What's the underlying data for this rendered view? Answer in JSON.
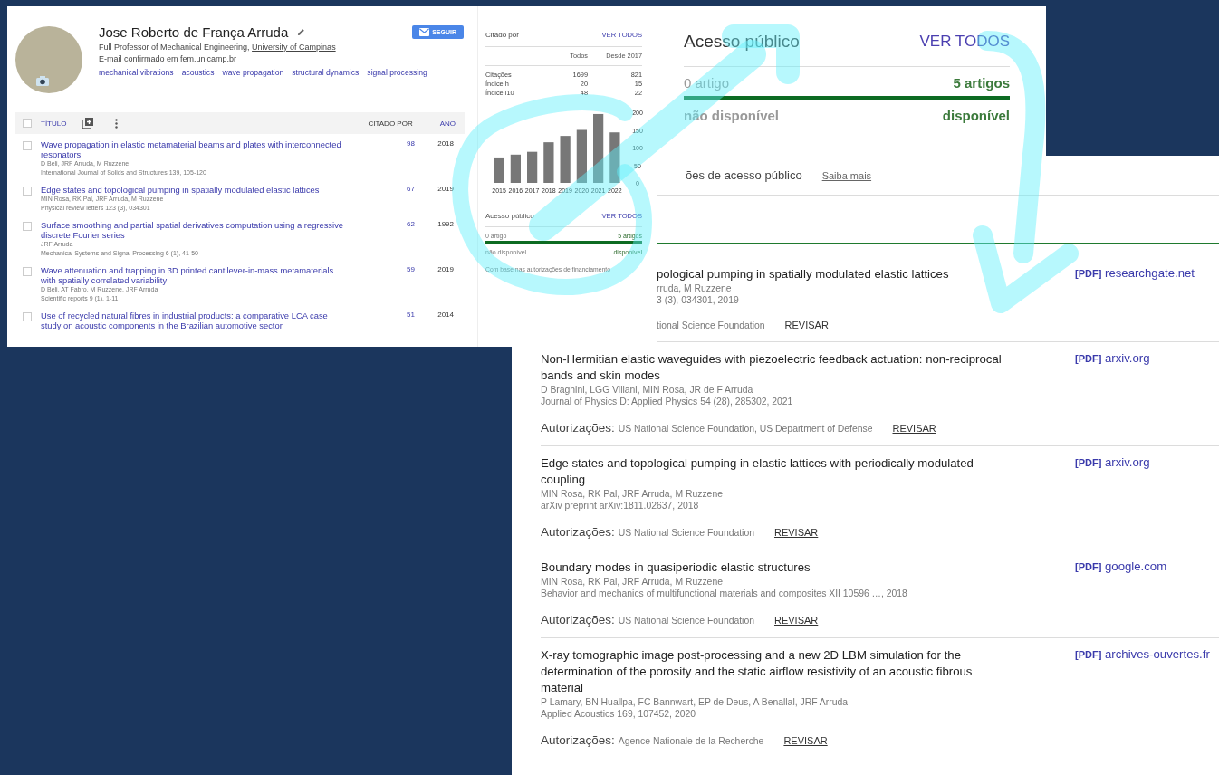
{
  "profile": {
    "name": "Jose Roberto de França Arruda",
    "affiliation": "Full Professor of Mechanical Engineering, ",
    "affiliation_link": "University of Campinas",
    "email": "E-mail confirmado em fem.unicamp.br",
    "interests": [
      "mechanical vibrations",
      "acoustics",
      "wave propagation",
      "structural dynamics",
      "signal processing"
    ],
    "follow_button": "SEGUIR"
  },
  "articles_table": {
    "header_checked": false,
    "columns": [
      {
        "label": "TÍTULO"
      },
      {
        "label": "CITADO POR"
      },
      {
        "label": "ANO"
      }
    ],
    "rows": [
      {
        "checked": false,
        "title": "Wave propagation in elastic metamaterial beams and plates with interconnected resonators",
        "authors": "D Beli, JRF Arruda, M Ruzzene",
        "venue": "International Journal of Solids and Structures 139, 105-120",
        "cited_by": "98",
        "year": "2018"
      },
      {
        "checked": false,
        "title": "Edge states and topological pumping in spatially modulated elastic lattices",
        "authors": "MIN Rosa, RK Pal, JRF Arruda, M Ruzzene",
        "venue": "Physical review letters 123 (3), 034301",
        "cited_by": "67",
        "year": "2019"
      },
      {
        "checked": false,
        "title": "Surface smoothing and partial spatial derivatives computation using a regressive discrete Fourier series",
        "authors": "JRF Arruda",
        "venue": "Mechanical Systems and Signal Processing 6 (1), 41-50",
        "cited_by": "62",
        "year": "1992"
      },
      {
        "checked": false,
        "title": "Wave attenuation and trapping in 3D printed cantilever-in-mass metamaterials with spatially correlated variability",
        "authors": "D Beli, AT Fabro, M Ruzzene, JRF Arruda",
        "venue": "Scientific reports 9 (1), 1-11",
        "cited_by": "59",
        "year": "2019"
      },
      {
        "checked": false,
        "title": "Use of recycled natural fibres in industrial products: a comparative LCA case study on acoustic components in the Brazilian automotive sector",
        "cited_by": "51",
        "year": "2014"
      }
    ]
  },
  "cited_by": {
    "title": "Citado por",
    "link": "VER TODOS",
    "columns": [
      "Todos",
      "Desde 2017"
    ],
    "rows": [
      {
        "label": "Citações",
        "all": "1699",
        "since": "821"
      },
      {
        "label": "Índice h",
        "all": "20",
        "since": "15"
      },
      {
        "label": "Índice i10",
        "all": "48",
        "since": "22"
      }
    ],
    "chart_data": {
      "type": "bar",
      "categories": [
        "2015",
        "2016",
        "2017",
        "2018",
        "2019",
        "2020",
        "2021",
        "2022"
      ],
      "values": [
        72,
        80,
        88,
        115,
        133,
        150,
        195,
        143
      ],
      "ylim": [
        0,
        200
      ],
      "yticks": [
        0,
        50,
        100,
        150,
        200
      ]
    }
  },
  "public_access": {
    "title": "Acesso público",
    "link": "VER TODOS",
    "unavailable_count": "0 artigo",
    "available_count": "5 artigos",
    "level": 1,
    "unavailable_label": "não disponível",
    "available_label": "disponível",
    "note": "Com base nas autorizações de financiamento"
  },
  "public_access_zoomed": {
    "title": "Acesso público",
    "link": "VER TODOS",
    "unavailable_count": "0 artigo",
    "available_count": "5 artigos",
    "level": 1,
    "unavailable_label": "não disponível",
    "available_label": "disponível"
  },
  "mandates_page": {
    "heading": "ões de acesso público",
    "learn_more": "Saiba mais",
    "articles": [
      {
        "title": "pological pumping in spatially modulated elastic lattices",
        "authors": "rruda, M Ruzzene",
        "venue": "3 (3), 034301, 2019",
        "funders": "tional Science Foundation",
        "review": "REVISAR",
        "pdf_tag": "[PDF]",
        "source": "researchgate.net"
      },
      {
        "title": "Non-Hermitian elastic waveguides with piezoelectric feedback actuation: non-reciprocal bands and skin modes",
        "authors": "D Braghini, LGG Villani, MIN Rosa, JR de F Arruda",
        "venue": "Journal of Physics D: Applied Physics 54 (28), 285302, 2021",
        "mandates_label": "Autorizações:",
        "funders": "US National Science Foundation, US Department of Defense",
        "review": "REVISAR",
        "pdf_tag": "[PDF]",
        "source": "arxiv.org"
      },
      {
        "title": "Edge states and topological pumping in elastic lattices with periodically modulated coupling",
        "authors": "MIN Rosa, RK Pal, JRF Arruda, M Ruzzene",
        "venue": "arXiv preprint arXiv:1811.02637, 2018",
        "mandates_label": "Autorizações:",
        "funders": "US National Science Foundation",
        "review": "REVISAR",
        "pdf_tag": "[PDF]",
        "source": "arxiv.org"
      },
      {
        "title": "Boundary modes in quasiperiodic elastic structures",
        "authors": "MIN Rosa, RK Pal, JRF Arruda, M Ruzzene",
        "venue": "Behavior and mechanics of multifunctional materials and composites XII 10596 …, 2018",
        "mandates_label": "Autorizações:",
        "funders": "US National Science Foundation",
        "review": "REVISAR",
        "pdf_tag": "[PDF]",
        "source": "google.com"
      },
      {
        "title": "X-ray tomographic image post-processing and a new 2D LBM simulation for the determination of the porosity and the static airflow resistivity of an acoustic fibrous material",
        "authors": "P Lamary, BN Huallpa, FC Bannwart, EP de Deus, A Benallal, JRF Arruda",
        "venue": "Applied Acoustics 169, 107452, 2020",
        "mandates_label": "Autorizações:",
        "funders": "Agence Nationale de la Recherche",
        "review": "REVISAR",
        "pdf_tag": "[PDF]",
        "source": "archives-ouvertes.fr"
      }
    ]
  }
}
